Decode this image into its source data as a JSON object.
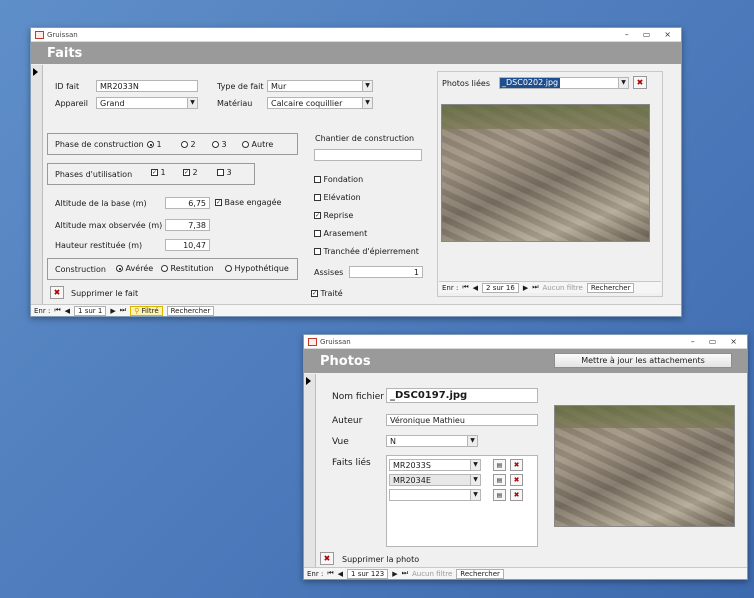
{
  "window_faits": {
    "app_title": "Gruissan",
    "form_title": "Faits",
    "id_fait": {
      "label": "ID fait",
      "value": "MR2033N"
    },
    "type_de_fait": {
      "label": "Type de fait",
      "value": "Mur"
    },
    "appareil": {
      "label": "Appareil",
      "value": "Grand"
    },
    "materiau": {
      "label": "Matériau",
      "value": "Calcaire coquillier"
    },
    "phase_construction": {
      "label": "Phase de construction",
      "options": [
        "1",
        "2",
        "3",
        "Autre"
      ],
      "selected": "1"
    },
    "phases_utilisation": {
      "label": "Phases d'utilisation",
      "options": [
        {
          "label": "1",
          "checked": true
        },
        {
          "label": "2",
          "checked": true
        },
        {
          "label": "3",
          "checked": false
        }
      ]
    },
    "altitude_base": {
      "label": "Altitude de la base (m)",
      "value": "6,75"
    },
    "base_engagee": {
      "label": "Base engagée",
      "checked": true
    },
    "altitude_max": {
      "label": "Altitude max observée (m)",
      "value": "7,38"
    },
    "hauteur_restituee": {
      "label": "Hauteur restituée (m)",
      "value": "10,47"
    },
    "construction": {
      "label": "Construction",
      "options": [
        "Avérée",
        "Restitution",
        "Hypothétique"
      ],
      "selected": "Avérée"
    },
    "chantier": {
      "label": "Chantier de construction",
      "value": ""
    },
    "chantier_checks": [
      {
        "label": "Fondation",
        "checked": false
      },
      {
        "label": "Elévation",
        "checked": false
      },
      {
        "label": "Reprise",
        "checked": true
      },
      {
        "label": "Arasement",
        "checked": false
      },
      {
        "label": "Tranchée d'épierrement",
        "checked": false
      }
    ],
    "assises": {
      "label": "Assises",
      "value": "1"
    },
    "traite": {
      "label": "Traité",
      "checked": true
    },
    "photos_liees": {
      "label": "Photos liées",
      "value": "_DSC0202.jpg"
    },
    "delete_label": "Supprimer le fait",
    "photo_nav": {
      "prefix": "Enr :",
      "record": "2 sur 16",
      "filter": "Aucun filtre",
      "search": "Rechercher"
    },
    "main_nav": {
      "prefix": "Enr :",
      "record": "1 sur 1",
      "filter": "Filtré",
      "search": "Rechercher"
    }
  },
  "window_photos": {
    "app_title": "Gruissan",
    "form_title": "Photos",
    "update_button": "Mettre à jour les attachements",
    "nom_fichier": {
      "label": "Nom fichier",
      "value": "_DSC0197.jpg"
    },
    "auteur": {
      "label": "Auteur",
      "value": "Véronique Mathieu"
    },
    "vue": {
      "label": "Vue",
      "value": "N"
    },
    "faits_lies": {
      "label": "Faits liés",
      "items": [
        "MR2033S",
        "MR2034E",
        ""
      ]
    },
    "delete_label": "Supprimer la photo",
    "nav": {
      "prefix": "Enr :",
      "record": "1 sur 123",
      "filter": "Aucun filtre",
      "search": "Rechercher"
    }
  }
}
